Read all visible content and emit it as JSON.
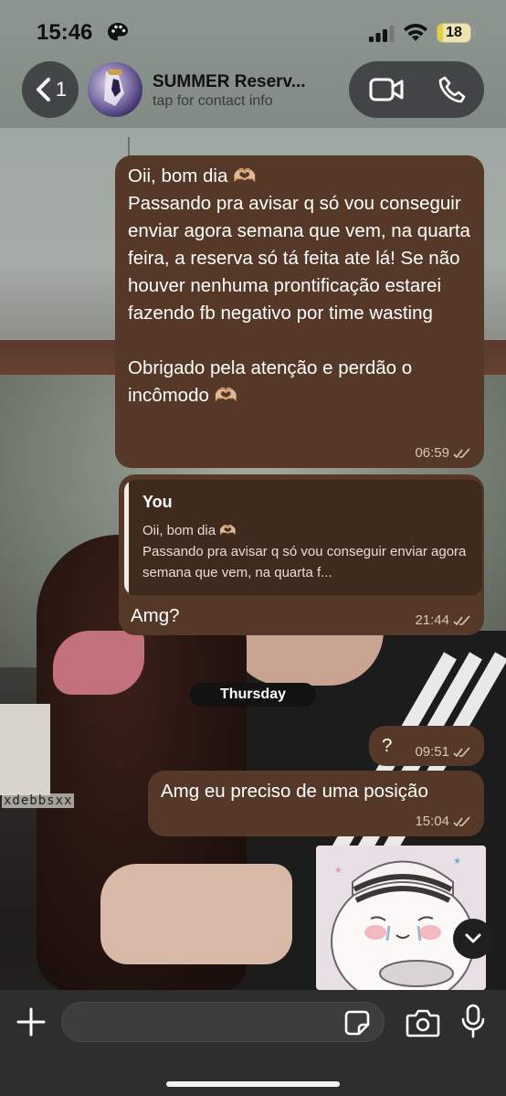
{
  "status_bar": {
    "time": "15:46",
    "battery_level": "18"
  },
  "header": {
    "back_count": "1",
    "contact_name": "SUMMER Reserv...",
    "contact_subtitle": "tap for contact info"
  },
  "messages": [
    {
      "direction": "outgoing",
      "text": "Oii, bom dia 🫶🏼\nPassando pra avisar q só vou conseguir enviar agora semana que vem, na quarta feira, a reserva só tá feita ate lá! Se não houver nenhuma prontificação estarei fazendo fb negativo por time wasting\n\nObrigado pela atenção e perdão o incômodo 🫶🏼",
      "time": "06:59"
    },
    {
      "direction": "outgoing",
      "reply_to": {
        "author": "You",
        "text": "Oii, bom dia 🫶🏼\nPassando pra avisar q só vou conseguir enviar agora semana que vem, na quarta f..."
      },
      "text": "Amg?",
      "time": "21:44"
    },
    {
      "direction": "outgoing",
      "text": "?",
      "time": "09:51"
    },
    {
      "direction": "outgoing",
      "text": "Amg eu preciso de uma posição",
      "time": "15:04"
    }
  ],
  "date_separator": "Thursday",
  "wallpaper_watermark": "xdebbsxx",
  "input": {
    "placeholder": ""
  },
  "colors": {
    "bubble": "#553827",
    "input_bar": "#2e2e2e"
  },
  "icons": [
    "back-chevron-icon",
    "video-call-icon",
    "phone-icon",
    "plus-icon",
    "sticker-icon",
    "camera-icon",
    "mic-icon",
    "chevron-down-icon",
    "read-ticks-icon",
    "palette-icon",
    "signal-icon",
    "wifi-icon",
    "battery-icon"
  ]
}
